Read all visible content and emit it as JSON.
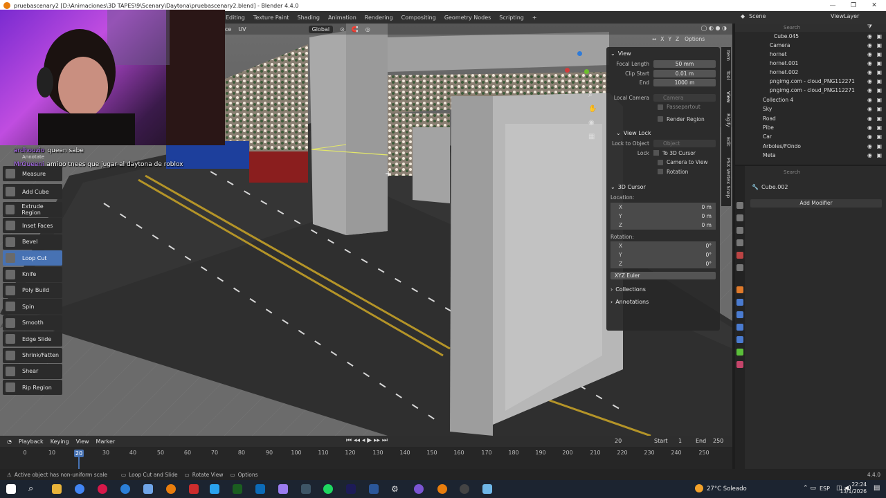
{
  "window": {
    "title": "pruebascenary2 [D:\\Animaciones\\3D TAPES\\9\\Scenary\\Daytona\\pruebascenary2.blend] - Blender 4.4.0"
  },
  "workspaces": [
    "Editing",
    "Texture Paint",
    "Shading",
    "Animation",
    "Rendering",
    "Compositing",
    "Geometry Nodes",
    "Scripting"
  ],
  "viewport_header": {
    "menu_items": [
      "ace",
      "UV"
    ],
    "orientation": "Global"
  },
  "scene": {
    "name": "Scene",
    "view_layer": "ViewLayer"
  },
  "options_label": "Options",
  "chat": [
    {
      "user": "ardhouzio",
      "message": "queen sabe"
    },
    {
      "user": "MrQueeni",
      "message": "amigo tnees que jugar al daytona de roblox"
    }
  ],
  "tools": [
    {
      "label": "Annotate",
      "icon": "annotate-icon"
    },
    {
      "label": "Measure",
      "icon": "measure-icon"
    },
    {
      "label": "Add Cube",
      "icon": "add-cube-icon"
    },
    {
      "label": "Extrude Region",
      "icon": "extrude-icon"
    },
    {
      "label": "Inset Faces",
      "icon": "inset-icon"
    },
    {
      "label": "Bevel",
      "icon": "bevel-icon"
    },
    {
      "label": "Loop Cut",
      "icon": "loop-cut-icon",
      "active": true
    },
    {
      "label": "Knife",
      "icon": "knife-icon"
    },
    {
      "label": "Poly Build",
      "icon": "poly-build-icon"
    },
    {
      "label": "Spin",
      "icon": "spin-icon"
    },
    {
      "label": "Smooth",
      "icon": "smooth-icon"
    },
    {
      "label": "Edge Slide",
      "icon": "edge-slide-icon"
    },
    {
      "label": "Shrink/Fatten",
      "icon": "shrink-fatten-icon"
    },
    {
      "label": "Shear",
      "icon": "shear-icon"
    },
    {
      "label": "Rip Region",
      "icon": "rip-icon"
    }
  ],
  "npanel": {
    "view": {
      "heading": "View",
      "focal_length_label": "Focal Length",
      "focal_length": "50 mm",
      "clip_start_label": "Clip Start",
      "clip_start": "0.01 m",
      "end_label": "End",
      "end": "1000 m",
      "local_camera_label": "Local Camera",
      "local_camera_placeholder": "Camera",
      "passepartout": "Passepartout",
      "render_region": "Render Region"
    },
    "view_lock": {
      "heading": "View Lock",
      "lock_to_object_label": "Lock to Object",
      "object_placeholder": "Object",
      "lock_label": "Lock",
      "to_3d_cursor": "To 3D Cursor",
      "camera_to_view": "Camera to View",
      "rotation": "Rotation"
    },
    "cursor": {
      "heading": "3D Cursor",
      "location_label": "Location:",
      "location": [
        {
          "axis": "X",
          "value": "0 m"
        },
        {
          "axis": "Y",
          "value": "0 m"
        },
        {
          "axis": "Z",
          "value": "0 m"
        }
      ],
      "rotation_label": "Rotation:",
      "rotation": [
        {
          "axis": "X",
          "value": "0°"
        },
        {
          "axis": "Y",
          "value": "0°"
        },
        {
          "axis": "Z",
          "value": "0°"
        }
      ],
      "rotation_mode": "XYZ Euler"
    },
    "collections": "Collections",
    "annotations": "Annotations",
    "tabs": [
      "Item",
      "Tool",
      "View",
      "Rigify",
      "Edit",
      "PSX Vertex Snap"
    ]
  },
  "outliner": {
    "search_placeholder": "Search",
    "rows": [
      {
        "name": "Cube.045",
        "type": "mesh"
      },
      {
        "name": "Camera",
        "type": "camera"
      },
      {
        "name": "hornet",
        "type": "object"
      },
      {
        "name": "hornet.001",
        "type": "object"
      },
      {
        "name": "hornet.002",
        "type": "object"
      },
      {
        "name": "pngimg.com - cloud_PNG112271",
        "type": "image"
      },
      {
        "name": "pngimg.com - cloud_PNG112271",
        "type": "image"
      },
      {
        "name": "Collection 4",
        "type": "collection"
      },
      {
        "name": "Sky",
        "type": "collection"
      },
      {
        "name": "Road",
        "type": "collection"
      },
      {
        "name": "Pibe",
        "type": "collection"
      },
      {
        "name": "Car",
        "type": "collection"
      },
      {
        "name": "Arboles/FOndo",
        "type": "collection"
      },
      {
        "name": "Meta",
        "type": "collection"
      }
    ]
  },
  "properties": {
    "search_placeholder": "Search",
    "object_name": "Cube.002",
    "add_modifier": "Add Modifier"
  },
  "timeline": {
    "menus": [
      "Playback",
      "Keying",
      "View",
      "Marker"
    ],
    "current_frame": "20",
    "start_label": "Start",
    "start": "1",
    "end_label": "End",
    "end": "250",
    "ticks": [
      "0",
      "10",
      "20",
      "30",
      "40",
      "50",
      "60",
      "70",
      "80",
      "90",
      "100",
      "110",
      "120",
      "130",
      "140",
      "150",
      "160",
      "170",
      "180",
      "190",
      "200",
      "210",
      "220",
      "230",
      "240",
      "250"
    ]
  },
  "statusbar": {
    "message": "Active object has non-uniform scale",
    "hint1": "Loop Cut and Slide",
    "hint2": "Rotate View",
    "hint3": "Options",
    "version": "4.4.0"
  },
  "taskbar": {
    "weather": "27°C  Soleado",
    "language": "ESP",
    "time": "22:24",
    "date": "13/1/2026"
  }
}
